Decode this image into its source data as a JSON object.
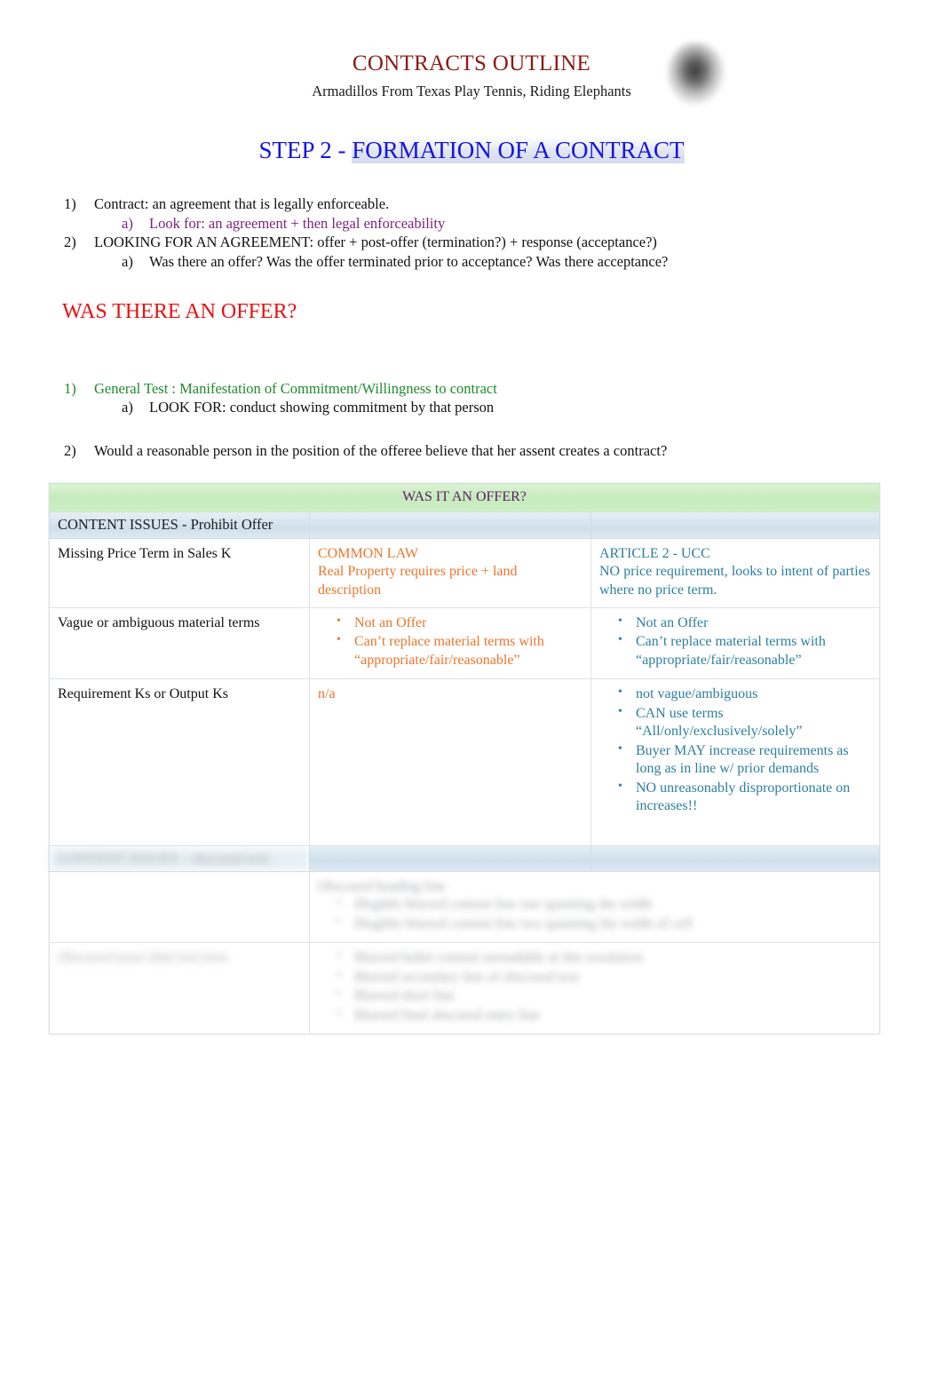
{
  "document": {
    "title": "CONTRACTS OUTLINE",
    "subtitle": "Armadillos From Texas Play Tennis, Riding Elephants",
    "header_image": "blurred-logo-image"
  },
  "step_heading": {
    "prefix": "STEP 2 - ",
    "highlight": "FORMATION OF A CONTRACT"
  },
  "outline_top": [
    {
      "marker": "1)",
      "text": "Contract: an agreement that is legally enforceable.",
      "color": "black",
      "level": 1
    },
    {
      "marker": "a)",
      "text": "Look for: an agreement + then legal enforceability",
      "color": "purple",
      "level": 2
    },
    {
      "marker": "2)",
      "text": "LOOKING FOR AN AGREEMENT: offer + post-offer (termination?) + response (acceptance?)",
      "color": "black",
      "level": 1
    },
    {
      "marker": "a)",
      "text": "Was there an offer?      Was the offer terminated prior to acceptance? Was there acceptance?",
      "color": "black",
      "level": 2
    }
  ],
  "section_heading": "WAS THERE AN OFFER?",
  "outline_second": [
    {
      "marker": "1)",
      "text": "General Test   : Manifestation of Commitment/Willingness to contract",
      "color": "green",
      "level": 1
    },
    {
      "marker": "a)",
      "text": "LOOK FOR: conduct showing commitment by that person",
      "color": "black",
      "level": 2
    },
    {
      "marker": "2)",
      "text": "Would a reasonable person in the position of the offeree believe that her assent creates a contract?",
      "color": "black",
      "level": 1
    }
  ],
  "table": {
    "banner": "WAS IT AN OFFER?",
    "section_one_label": "CONTENT ISSUES - Prohibit Offer",
    "section_two_label": "CONTENT ISSUES - blurred/illegible",
    "column_headers": {
      "issue": "",
      "common_law": "COMMON LAW",
      "article_2": "ARTICLE 2 - UCC"
    },
    "rows": [
      {
        "issue": "Missing Price Term in Sales K",
        "common_law_intro": "COMMON LAW",
        "common_law_text": "Real Property requires price + land description",
        "article_2_intro": "ARTICLE 2 - UCC",
        "article_2_text": "NO price requirement, looks to    intent   of parties where no price term."
      },
      {
        "issue": "Vague or ambiguous material terms",
        "common_law_bullets": [
          "Not an Offer",
          "Can’t replace material terms with “appropriate/fair/reasonable”"
        ],
        "article_2_bullets": [
          "Not an Offer",
          "Can’t replace material terms with “appropriate/fair/reasonable”"
        ]
      },
      {
        "issue": "Requirement Ks or Output Ks",
        "common_law_text": "n/a",
        "article_2_bullets": [
          "not vague/ambiguous",
          "CAN use terms “All/only/exclusively/solely”",
          "Buyer MAY increase requirements as long as in line w/ prior demands",
          "NO unreasonably disproportionate on increases!!"
        ]
      }
    ],
    "blurred_rows": [
      {
        "issue": "",
        "common_law_bullets": [
          "",
          "",
          ""
        ],
        "article_2_bullets": [
          "",
          ""
        ]
      },
      {
        "issue": "",
        "common_law_bullets": [
          "",
          "",
          "",
          ""
        ],
        "article_2_bullets": [
          "",
          ""
        ]
      }
    ]
  },
  "colors": {
    "title_red": "#8B1A13",
    "heading_blue": "#1414E6",
    "section_red": "#E8110F",
    "purple": "#7B247B",
    "green": "#1F8A2E",
    "orange": "#E8762C",
    "teal": "#2D7F9D",
    "banner_green": "#C6EBBD",
    "banner_blue": "#CFE0EC",
    "banner_text_purple": "#5B2060"
  }
}
